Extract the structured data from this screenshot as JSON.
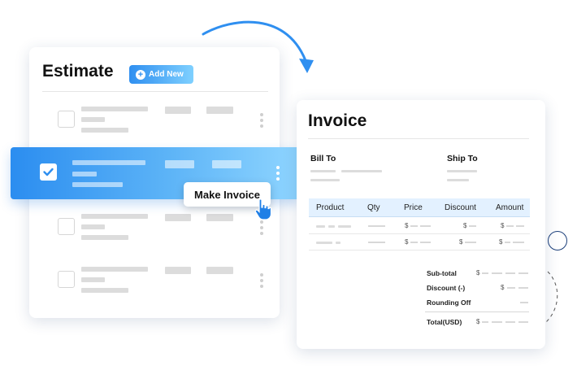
{
  "estimate": {
    "title": "Estimate",
    "add_button_label": "Add New",
    "rows_count": 4,
    "selected_row_index": 1
  },
  "tooltip": {
    "label": "Make Invoice"
  },
  "invoice": {
    "title": "Invoice",
    "bill_to_label": "Bill To",
    "ship_to_label": "Ship To",
    "columns": [
      "Product",
      "Qty",
      "Price",
      "Discount",
      "Amount"
    ],
    "currency_symbol": "$",
    "totals": {
      "subtotal_label": "Sub-total",
      "discount_label": "Discount (-)",
      "rounding_label": "Rounding Off",
      "total_label": "Total(USD)"
    }
  },
  "colors": {
    "accent": "#2f8ff0",
    "accent_light": "#8fd5ff",
    "table_header_bg": "#e3f1ff",
    "placeholder": "#dcdcdc"
  },
  "icons": {
    "add": "plus-circle-icon",
    "check": "checkmark-icon",
    "menu": "kebab-menu-icon",
    "cursor": "hand-pointer-icon",
    "flow": "curved-arrow-icon"
  }
}
